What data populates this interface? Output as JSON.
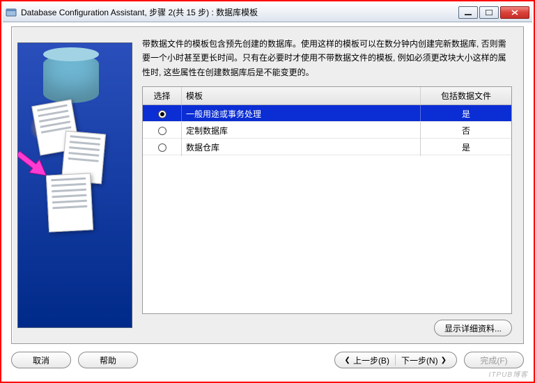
{
  "window": {
    "title": "Database Configuration Assistant, 步骤 2(共 15 步) : 数据库模板",
    "min_tooltip": "Minimize",
    "max_tooltip": "Maximize",
    "close_tooltip": "Close"
  },
  "description": "带数据文件的模板包含预先创建的数据库。使用这样的模板可以在数分钟内创建完新数据库, 否则需要一个小时甚至更长时间。只有在必要时才使用不带数据文件的模板, 例如必须更改块大小这样的属性时, 这些属性在创建数据库后是不能变更的。",
  "table": {
    "headers": {
      "select": "选择",
      "template": "模板",
      "datafiles": "包括数据文件"
    },
    "rows": [
      {
        "selected": true,
        "template": "一般用途或事务处理",
        "datafiles": "是"
      },
      {
        "selected": false,
        "template": "定制数据库",
        "datafiles": "否"
      },
      {
        "selected": false,
        "template": "数据仓库",
        "datafiles": "是"
      }
    ]
  },
  "buttons": {
    "details": "显示详细资料...",
    "cancel": "取消",
    "help": "帮助",
    "back": "上一步(B)",
    "next": "下一步(N)",
    "finish": "完成(F)"
  },
  "watermark": "ITPUB博客"
}
